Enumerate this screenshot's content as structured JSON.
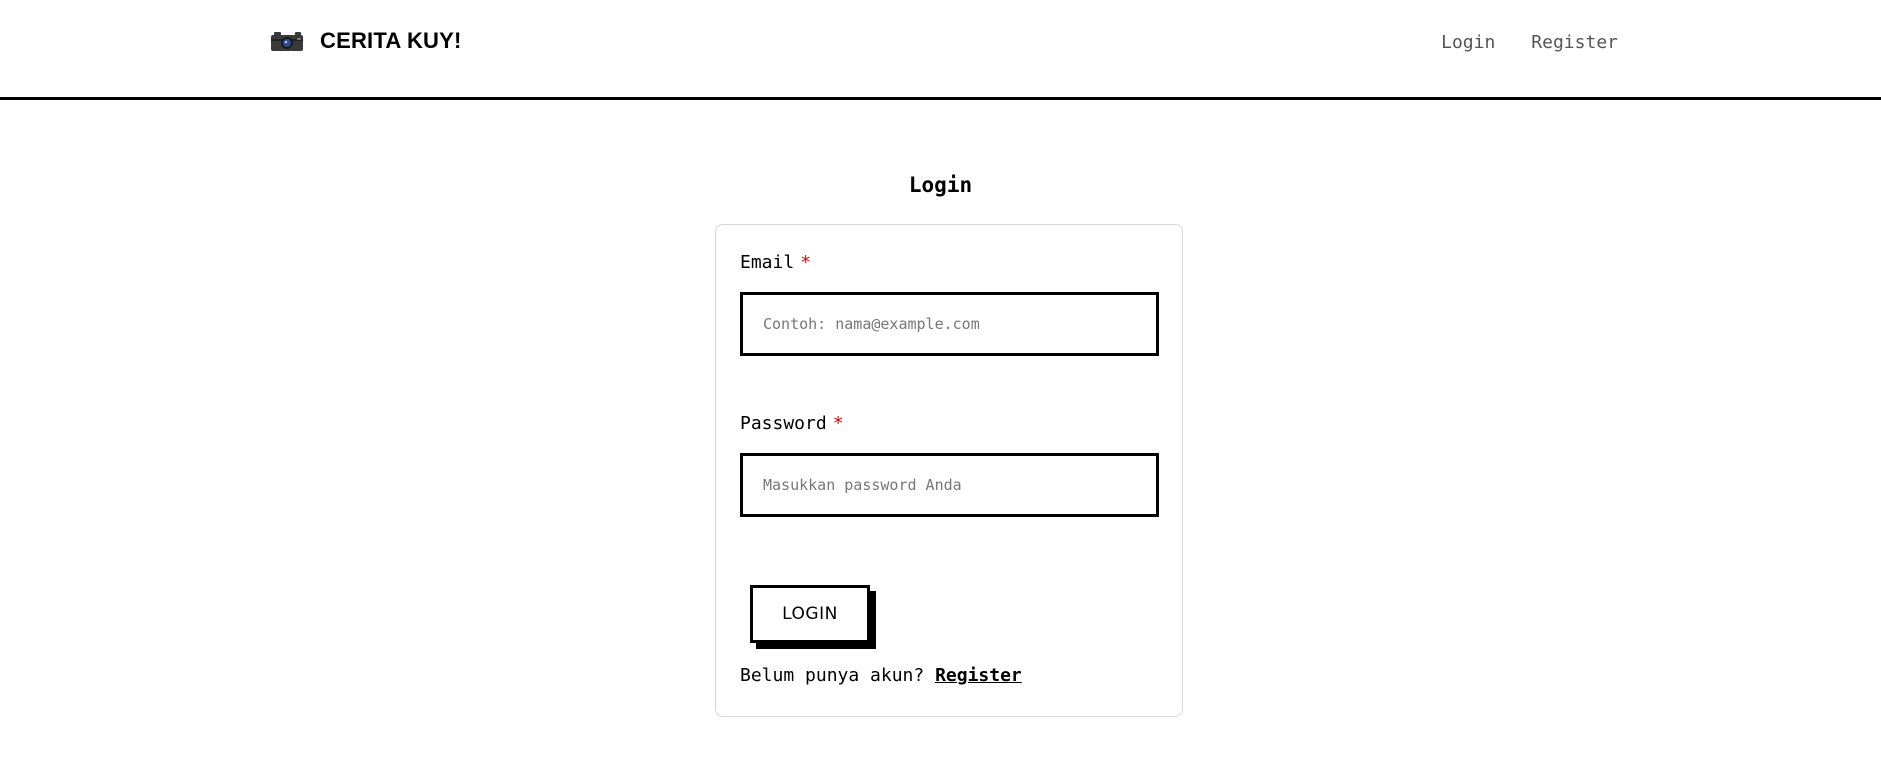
{
  "header": {
    "brand_icon": "camera-icon",
    "brand_title": "CERITA KUY!",
    "nav": {
      "login": "Login",
      "register": "Register"
    }
  },
  "main": {
    "title": "Login",
    "form": {
      "email": {
        "label": "Email",
        "required_mark": "*",
        "placeholder": "Contoh: nama@example.com",
        "value": ""
      },
      "password": {
        "label": "Password",
        "required_mark": "*",
        "placeholder": "Masukkan password Anda",
        "value": ""
      },
      "submit_label": "LOGIN",
      "footer_text": "Belum punya akun?",
      "footer_link": "Register"
    }
  },
  "colors": {
    "required": "#e00000",
    "border": "#000000",
    "card_border": "#d6d6d6",
    "nav_text": "#555555"
  }
}
